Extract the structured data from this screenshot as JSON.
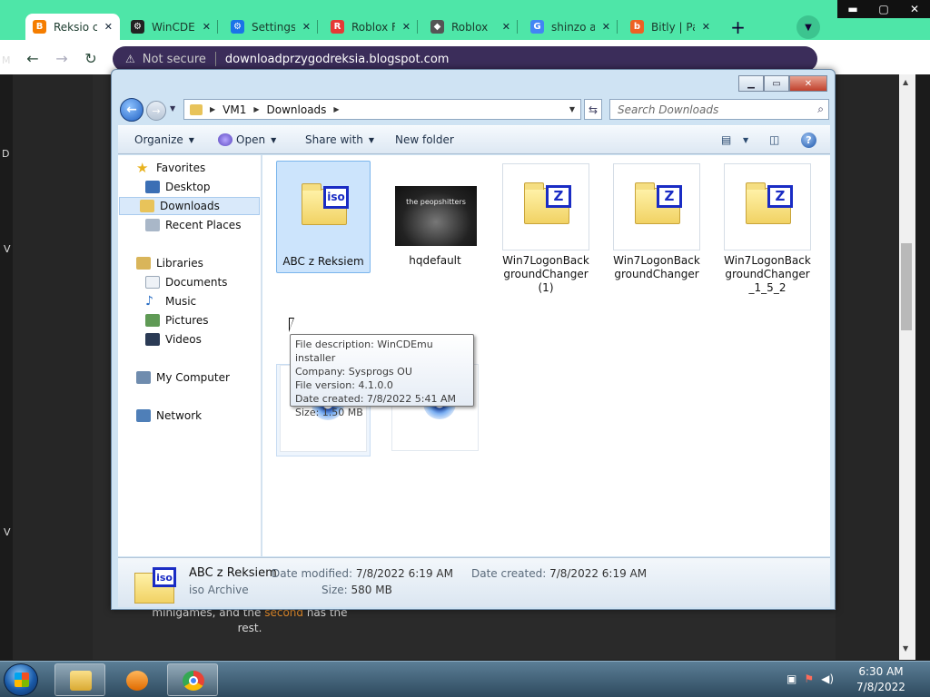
{
  "browser": {
    "tabs": [
      {
        "label": "Reksio c",
        "icon": "blogger-icon",
        "color": "#f57d00"
      },
      {
        "label": "WinCDE",
        "icon": "gear-icon",
        "color": "#222222"
      },
      {
        "label": "Settings",
        "icon": "settings-icon",
        "color": "#1a73e8"
      },
      {
        "label": "Roblox F",
        "icon": "roblox-icon",
        "color": "#e53935"
      },
      {
        "label": "Roblox",
        "icon": "roblox-icon",
        "color": "#555555"
      },
      {
        "label": "shinzo a",
        "icon": "google-icon",
        "color": "#4285f4"
      },
      {
        "label": "Bitly | Pa",
        "icon": "bitly-icon",
        "color": "#ee6123"
      }
    ],
    "new_tab": "+",
    "address": {
      "security": "Not secure",
      "url": "downloadprzygodreksia.blogspot.com"
    },
    "accent": "#4ee6a8"
  },
  "page": {
    "text_a": "minigames, and the ",
    "text_link": "second",
    "text_b": " has the rest.",
    "left_marks": [
      "M",
      "D",
      "V",
      "V"
    ]
  },
  "explorer": {
    "breadcrumbs": [
      "VM1",
      "Downloads"
    ],
    "search_placeholder": "Search Downloads",
    "commands": {
      "organize": "Organize",
      "open": "Open",
      "share": "Share with",
      "new_folder": "New folder"
    },
    "nav": {
      "favorites": "Favorites",
      "desktop": "Desktop",
      "downloads": "Downloads",
      "recent": "Recent Places",
      "libraries": "Libraries",
      "documents": "Documents",
      "music": "Music",
      "pictures": "Pictures",
      "videos": "Videos",
      "computer": "My Computer",
      "network": "Network"
    },
    "files": [
      {
        "name": "ABC z Reksiem",
        "type": "iso"
      },
      {
        "name": "hqdefault",
        "type": "image",
        "thumb_text": "the peopshitters"
      },
      {
        "name": "Win7LogonBackgroundChanger (1)",
        "type": "zip"
      },
      {
        "name": "Win7LogonBackgroundChanger",
        "type": "zip"
      },
      {
        "name": "Win7LogonBackgroundChanger_1_5_2",
        "type": "zip"
      },
      {
        "name": "",
        "type": "installer"
      },
      {
        "name": "",
        "type": "installer"
      }
    ],
    "tooltip": {
      "line1": "File description: WinCDEmu installer",
      "line2": "Company: Sysprogs OU",
      "line3": "File version: 4.1.0.0",
      "line4": "Date created: 7/8/2022 5:41 AM",
      "line5": "Size: 1.50 MB"
    },
    "details": {
      "name": "ABC z Reksiem",
      "kind": "iso Archive",
      "modified_label": "Date modified:",
      "modified": "7/8/2022 6:19 AM",
      "created_label": "Date created:",
      "created": "7/8/2022 6:19 AM",
      "size_label": "Size:",
      "size": "580 MB"
    },
    "iso_badge": "iso",
    "zip_badge": "Z"
  },
  "taskbar": {
    "time": "6:30 AM",
    "date": "7/8/2022"
  }
}
